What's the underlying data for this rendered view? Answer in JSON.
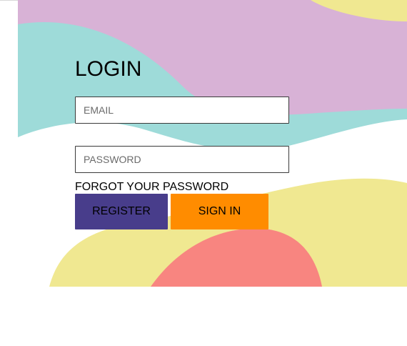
{
  "login": {
    "title": "LOGIN",
    "email_placeholder": "EMAIL",
    "password_placeholder": "PASSWORD",
    "forgot_label": "FORGOT YOUR PASSWORD",
    "register_label": "REGISTER",
    "signin_label": "SIGN IN"
  },
  "colors": {
    "purple_blob": "#d8b2d6",
    "teal_blob": "#9edbd9",
    "yellow_blob": "#f0e891",
    "salmon_blob": "#f88580",
    "register_button": "#483d8b",
    "signin_button": "#ff8c00"
  }
}
